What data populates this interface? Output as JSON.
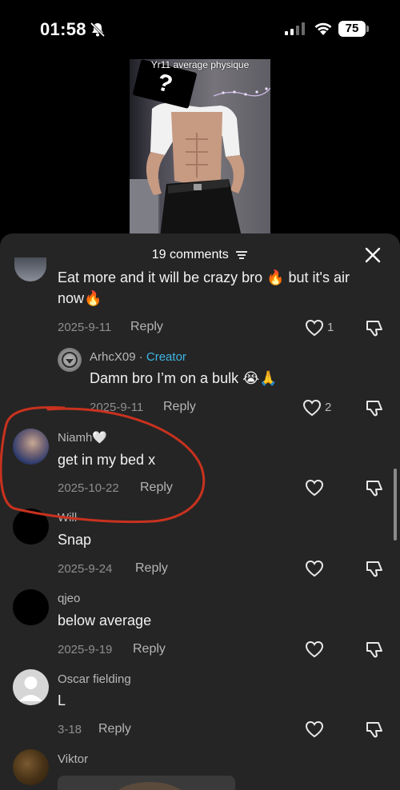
{
  "status_bar": {
    "time": "01:58",
    "battery": "75"
  },
  "video": {
    "caption": "Yr11 average physique",
    "face_cover": "?"
  },
  "comments_sheet": {
    "title": "19 comments",
    "comments": [
      {
        "text_line1": "Eat more and it will be crazy bro 🔥 but it's air",
        "text_line2": "now🔥",
        "date": "2025-9-11",
        "reply_label": "Reply",
        "likes": "1"
      },
      {
        "name": "ArhcX09",
        "creator_label": "Creator",
        "text": "Damn bro I’m on a bulk 😭🙏",
        "date": "2025-9-11",
        "reply_label": "Reply",
        "likes": "2"
      },
      {
        "name": "Niamh🤍",
        "text": "get in my bed x",
        "date": "2025-10-22",
        "reply_label": "Reply"
      },
      {
        "name": "Will",
        "text": "Snap",
        "date": "2025-9-24",
        "reply_label": "Reply"
      },
      {
        "name": "qjeo",
        "text": "below average",
        "date": "2025-9-19",
        "reply_label": "Reply"
      },
      {
        "name": "Oscar fielding",
        "text": "L",
        "date": "3-18",
        "reply_label": "Reply"
      },
      {
        "name": "Viktor"
      }
    ]
  },
  "colors": {
    "sheet_bg": "#252525",
    "creator_accent": "#3fb6e6",
    "annotation_red": "#c8321e"
  }
}
